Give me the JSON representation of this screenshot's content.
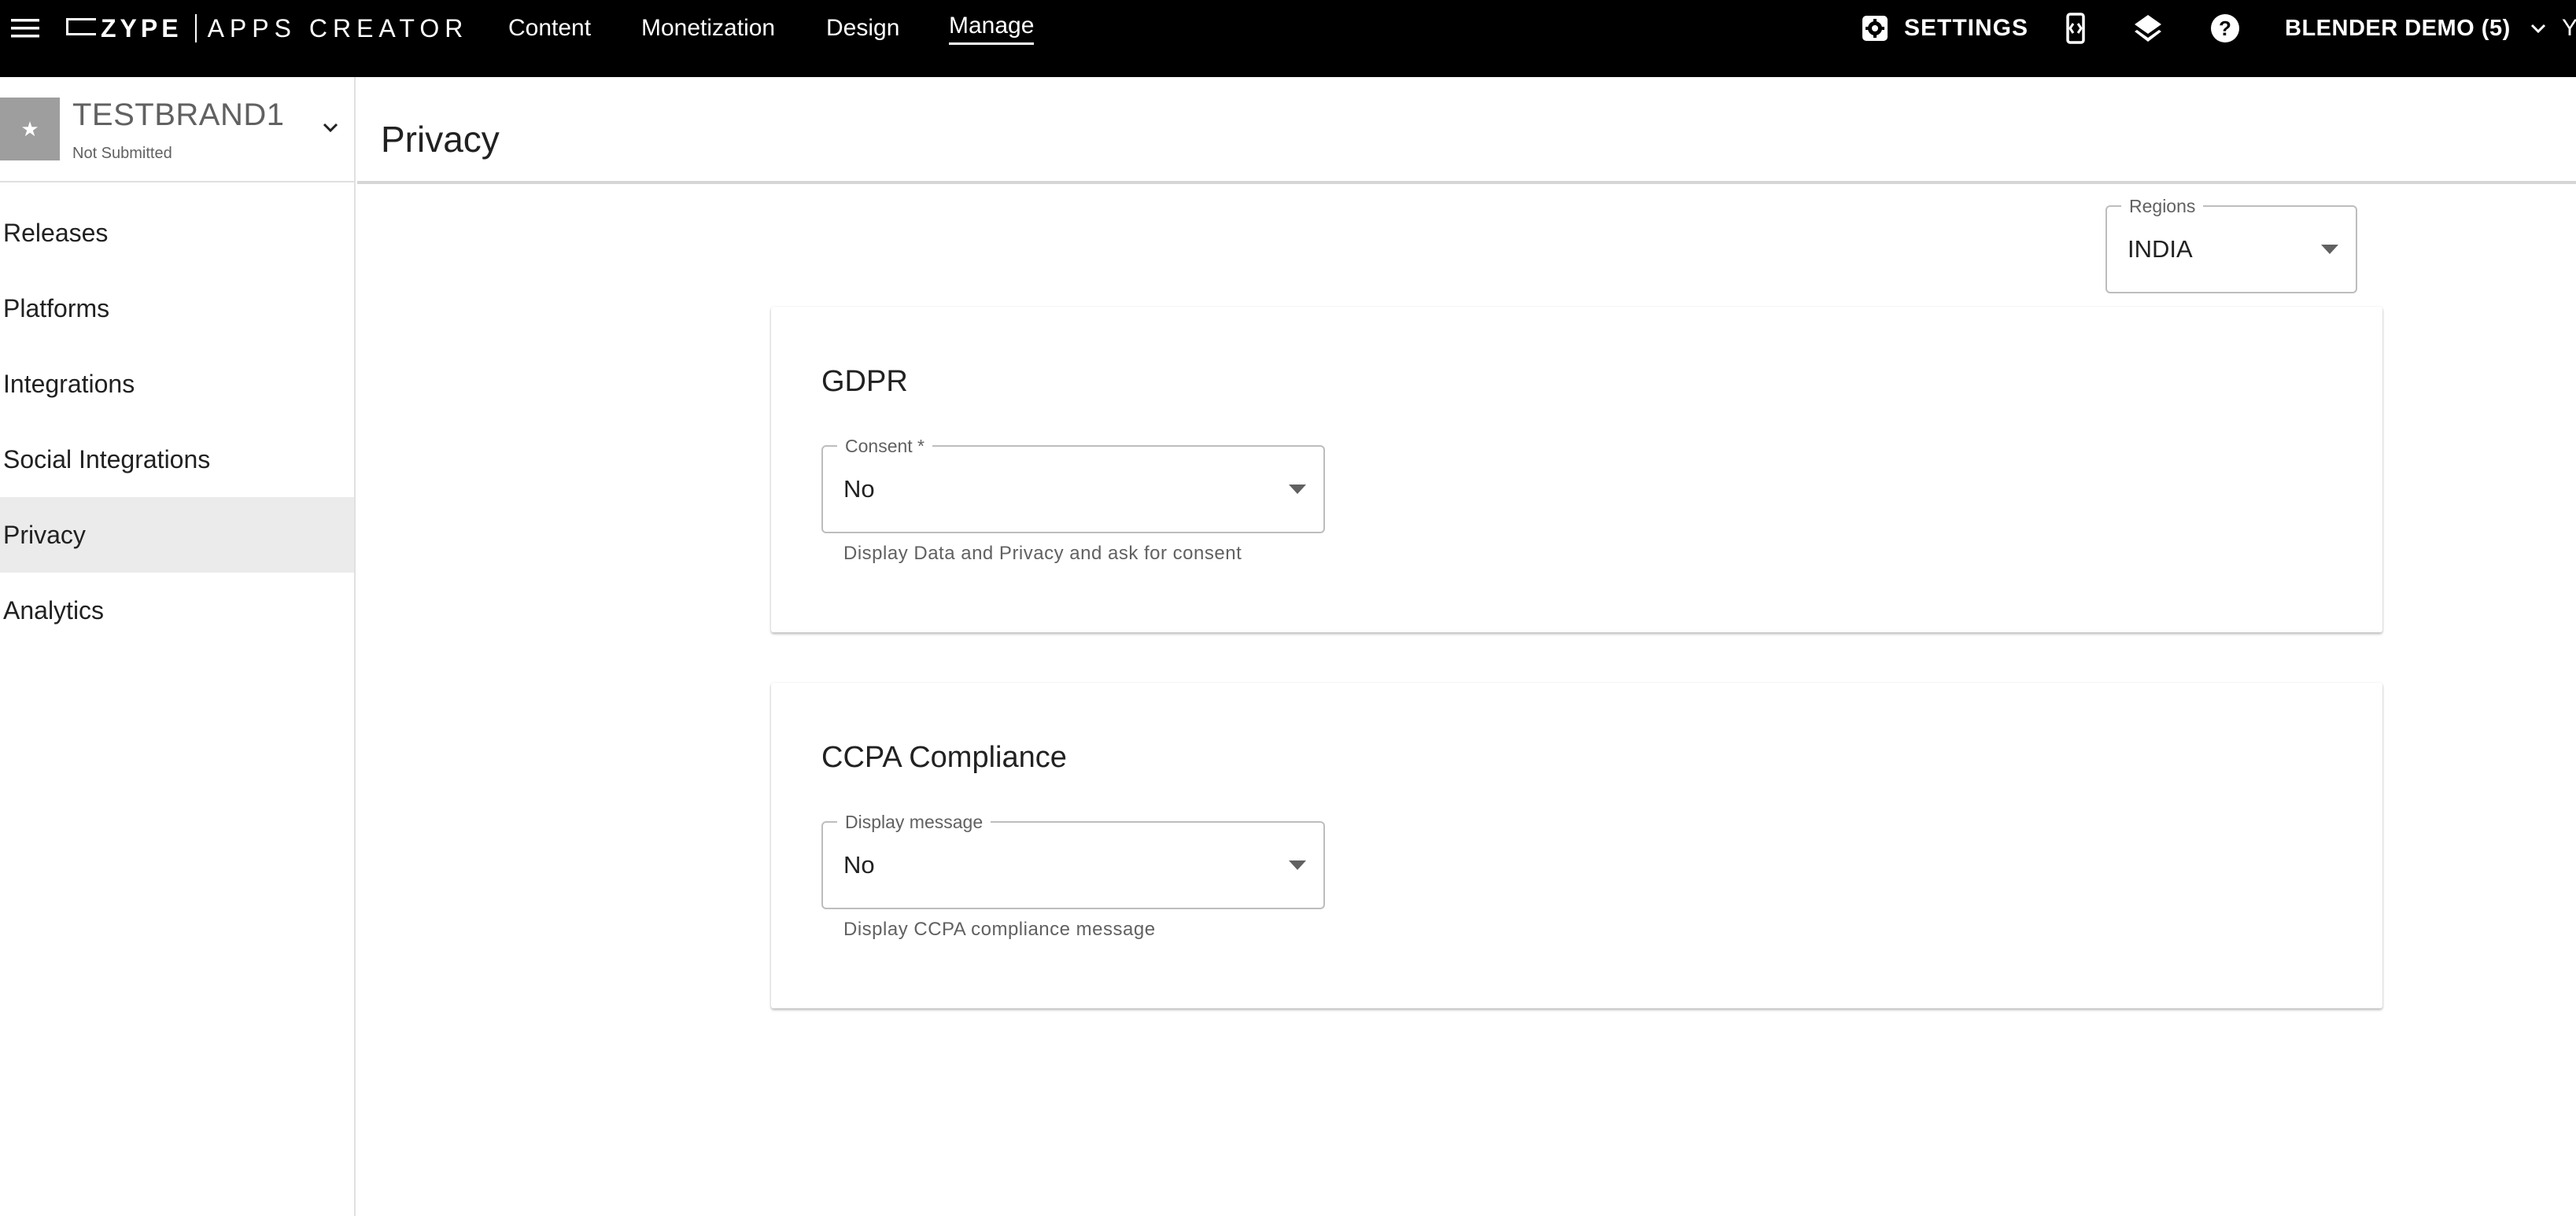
{
  "topbar": {
    "logo_brand": "ZYPE",
    "logo_product": "APPS CREATOR",
    "nav": [
      "Content",
      "Monetization",
      "Design",
      "Manage"
    ],
    "active_nav": "Manage",
    "settings_label": "SETTINGS",
    "account_label": "BLENDER DEMO (5)",
    "overflow_text": "Y",
    "icons": [
      "hamburger-menu-icon",
      "gear-icon",
      "device-preview-icon",
      "layers-icon",
      "help-icon",
      "chevron-down-icon"
    ]
  },
  "sidebar": {
    "brand_name": "TESTBRAND1",
    "brand_status": "Not Submitted",
    "brand_thumb_glyph": "★",
    "items": [
      {
        "label": "Releases",
        "active": false
      },
      {
        "label": "Platforms",
        "active": false
      },
      {
        "label": "Integrations",
        "active": false
      },
      {
        "label": "Social Integrations",
        "active": false
      },
      {
        "label": "Privacy",
        "active": true
      },
      {
        "label": "Analytics",
        "active": false
      }
    ]
  },
  "main": {
    "page_title": "Privacy",
    "regions": {
      "label": "Regions",
      "value": "INDIA"
    },
    "gdpr": {
      "title": "GDPR",
      "field_label": "Consent *",
      "value": "No",
      "helper": "Display Data and Privacy and ask for consent"
    },
    "ccpa": {
      "title": "CCPA Compliance",
      "field_label": "Display message",
      "value": "No",
      "helper": "Display CCPA compliance message"
    }
  },
  "colors": {
    "topbar_bg": "#000000",
    "active_sidebar_bg": "#ebebeb",
    "text_primary": "#212121",
    "text_secondary": "#616161"
  }
}
